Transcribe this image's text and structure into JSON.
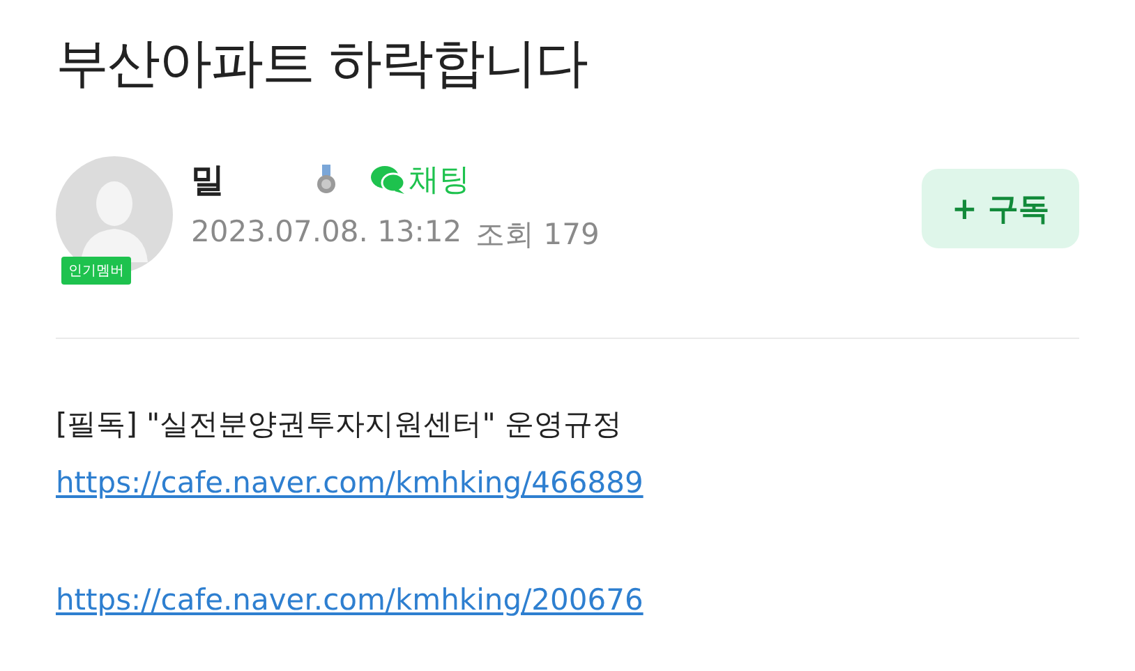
{
  "post": {
    "title": "부산아파트 하락합니다"
  },
  "author": {
    "name": "밀",
    "badge": "인기멤버",
    "chat": "채팅",
    "date": "2023.07.08. 13:12",
    "views": "조회 179"
  },
  "subscribe": {
    "label": "+ 구독"
  },
  "body": [
    {
      "kind": "text",
      "text": "[필독] \"실전분양권투자지원센터\" 운영규정"
    },
    {
      "kind": "link",
      "text": "https://cafe.naver.com/kmhking/466889"
    },
    {
      "kind": "blank"
    },
    {
      "kind": "link",
      "text": "https://cafe.naver.com/kmhking/200676"
    }
  ]
}
